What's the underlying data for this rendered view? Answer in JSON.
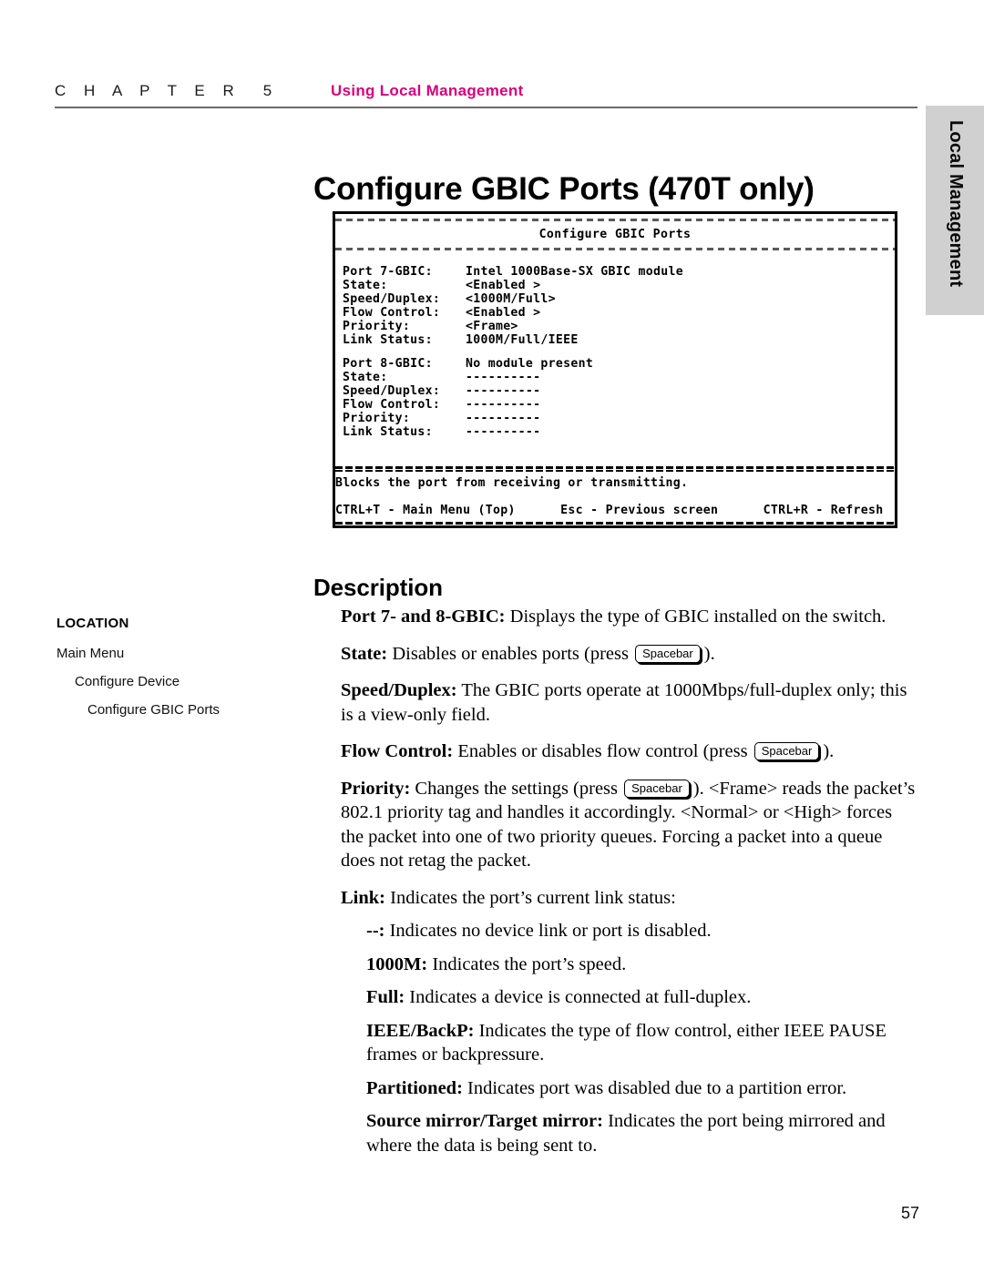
{
  "header": {
    "chapter_word": "C H A P T E R",
    "chapter_number": "5",
    "chapter_title": "Using Local Management"
  },
  "side_tab": {
    "label": "Local Management"
  },
  "page_title": "Configure GBIC Ports (470T only)",
  "terminal": {
    "title": "Configure GBIC Ports",
    "port7": {
      "rows": [
        {
          "label": "Port 7-GBIC:",
          "value": "Intel 1000Base-SX GBIC module"
        },
        {
          "label": "State:",
          "value": "<Enabled >"
        },
        {
          "label": "Speed/Duplex:",
          "value": "<1000M/Full>"
        },
        {
          "label": "Flow Control:",
          "value": "<Enabled >"
        },
        {
          "label": "Priority:",
          "value": "<Frame>"
        },
        {
          "label": "Link Status:",
          "value": "1000M/Full/IEEE"
        }
      ]
    },
    "port8": {
      "rows": [
        {
          "label": "Port 8-GBIC:",
          "value": "No module present"
        },
        {
          "label": "State:",
          "value": "----------"
        },
        {
          "label": "Speed/Duplex:",
          "value": "----------"
        },
        {
          "label": "Flow Control:",
          "value": "----------"
        },
        {
          "label": "Priority:",
          "value": "----------"
        },
        {
          "label": "Link Status:",
          "value": "----------"
        }
      ]
    },
    "status_line": "Blocks the port from receiving or transmitting.",
    "key_line": "CTRL+T - Main Menu (Top)      Esc - Previous screen      CTRL+R - Refresh"
  },
  "description_heading": "Description",
  "location": {
    "title": "LOCATION",
    "items": [
      {
        "label": "Main Menu"
      },
      {
        "label": "Configure Device"
      },
      {
        "label": "Configure GBIC Ports"
      }
    ]
  },
  "keycap_label": "Spacebar",
  "body": {
    "p_port": {
      "term": "Port 7- and 8-GBIC:",
      "text": " Displays the type of GBIC installed on the switch."
    },
    "p_state": {
      "term": "State:",
      "text_before": " Disables or enables ports (press ",
      "text_after": ")."
    },
    "p_speed": {
      "term": "Speed/Duplex:",
      "text": " The GBIC ports operate at 1000Mbps/full-duplex only; this is a view-only field."
    },
    "p_flow": {
      "term": "Flow Control:",
      "text_before": " Enables or disables flow control (press ",
      "text_after": ")."
    },
    "p_priority": {
      "term": "Priority:",
      "text_before": " Changes the settings (press ",
      "text_after": "). <Frame> reads the packet’s 802.1 priority tag and handles it accordingly. <Normal> or <High> forces the packet into one of two priority queues. Forcing a packet into a queue does not retag the packet."
    },
    "p_link": {
      "term": "Link:",
      "text": " Indicates the port’s current link status:"
    },
    "p_dash": {
      "term": "--:",
      "text": " Indicates no device link or port is disabled."
    },
    "p_1000m": {
      "term": "1000M:",
      "text": " Indicates the port’s speed."
    },
    "p_full": {
      "term": "Full:",
      "text": " Indicates a device is connected at full-duplex."
    },
    "p_ieee": {
      "term": "IEEE/BackP:",
      "text": " Indicates the type of flow control, either IEEE PAUSE frames or backpressure."
    },
    "p_partitioned": {
      "term": "Partitioned:",
      "text": " Indicates port was disabled due to a partition error."
    },
    "p_mirror": {
      "term": "Source mirror/Target mirror:",
      "text": " Indicates the port being mirrored and where the data is being sent to."
    }
  },
  "page_number": "57"
}
